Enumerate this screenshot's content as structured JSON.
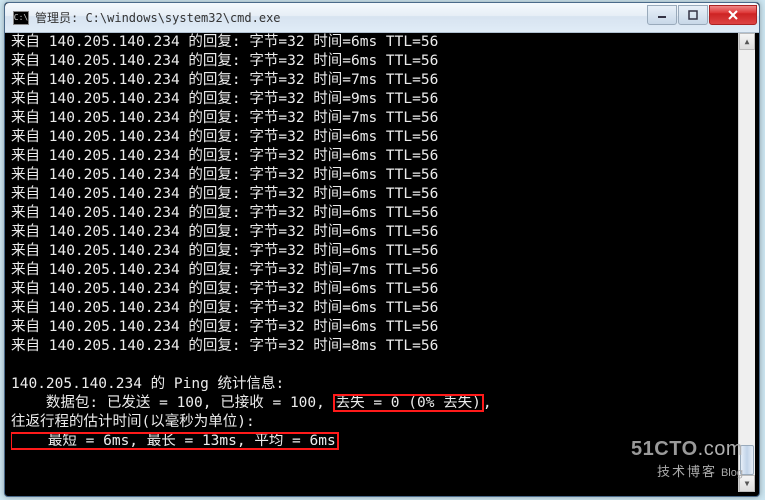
{
  "window": {
    "icon_text": "C:\\",
    "title": "管理员: C:\\windows\\system32\\cmd.exe"
  },
  "ping": {
    "prefix": "来自 ",
    "ip": "140.205.140.234",
    "reply_label": " 的回复: ",
    "bytes_label": "字节=",
    "bytes": 32,
    "time_label": " 时间=",
    "ttl_label": " TTL=",
    "ttl": 56,
    "times_ms": [
      6,
      6,
      7,
      9,
      7,
      6,
      6,
      6,
      6,
      6,
      6,
      6,
      7,
      6,
      6,
      6,
      8
    ]
  },
  "stats": {
    "header_a": "140.205.140.234",
    "header_b": " 的 Ping 统计信息:",
    "packets_prefix": "    数据包: 已发送 = ",
    "sent": 100,
    "recv_label": ", 已接收 = ",
    "recv": 100,
    "sep": ", ",
    "loss_text": "丢失 = 0 (0% 丢失)",
    "loss_suffix": ",",
    "rtt_line": "往返行程的估计时间(以毫秒为单位):",
    "rtt_values": "    最短 = 6ms, 最长 = 13ms, 平均 = 6ms"
  },
  "watermark": {
    "line1a": "51CTO",
    "line1b": ".com",
    "line2a": "技术博客",
    "line2b": "Blog"
  }
}
